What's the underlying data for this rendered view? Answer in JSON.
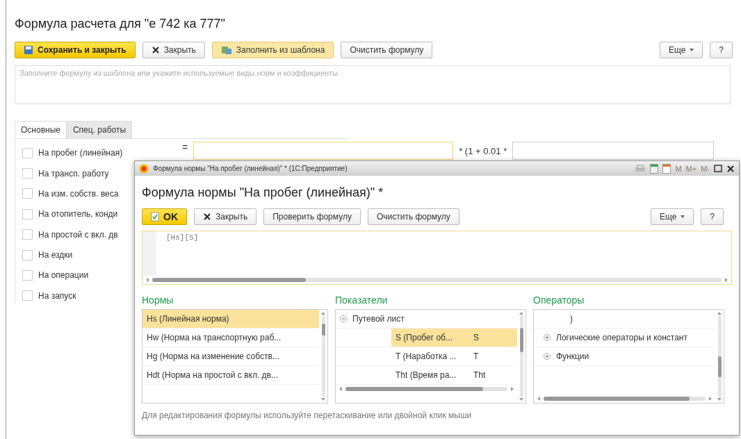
{
  "window": {
    "title": "Формула расчета для \"е 742 ка 777\""
  },
  "toolbar": {
    "buttons": [
      {
        "label": "Сохранить и закрыть",
        "kind": "primary"
      },
      {
        "label": "Закрыть",
        "kind": "close"
      },
      {
        "label": "Заполнить из шаблона",
        "kind": "template"
      },
      {
        "label": "Очистить формулу",
        "kind": "plain"
      }
    ],
    "more": "Еще",
    "help": "?"
  },
  "hint": {
    "placeholder": "Заполните формулу из шаблона или укажите используемые виды норм и коэффициенты"
  },
  "tabs": [
    {
      "label": "Основные",
      "selected": true
    },
    {
      "label": "Спец. работы",
      "selected": false
    }
  ],
  "norms": [
    {
      "label": "На пробег (линейная)",
      "checked": false
    },
    {
      "label": "На трансп. работу",
      "checked": false
    },
    {
      "label": "На изм. собств. веса",
      "checked": false
    },
    {
      "label": "На отопитель, конди",
      "checked": false
    },
    {
      "label": "На простой с вкл. дв",
      "checked": false
    },
    {
      "label": "На ездки",
      "checked": false
    },
    {
      "label": "На операции",
      "checked": false
    },
    {
      "label": "На запуск",
      "checked": false
    }
  ],
  "formula_row": {
    "equals": "=",
    "multiplier": "* (1 + 0.01 *"
  },
  "dialog": {
    "title_bar": "Формула нормы \"На пробег (линейная)\" *  (1С:Предприятие)",
    "memory_buttons": [
      "M",
      "M+",
      "M-"
    ],
    "heading": "Формула нормы \"На пробег (линейная)\" *",
    "toolbar": {
      "buttons": [
        {
          "label": "OK",
          "kind": "ok"
        },
        {
          "label": "Закрыть",
          "kind": "close"
        },
        {
          "label": "Проверить формулу",
          "kind": "plain"
        },
        {
          "label": "Очистить формулу",
          "kind": "plain"
        }
      ],
      "more": "Еще",
      "help": "?"
    },
    "formula": "[Hs][S]",
    "norms": {
      "title": "Нормы",
      "items": [
        {
          "label": "Hs (Линейная норма)",
          "selected": true
        },
        {
          "label": "Hw (Норма на транспортную раб...",
          "selected": false
        },
        {
          "label": "Hg (Норма на изменение собств...",
          "selected": false
        },
        {
          "label": "Hdt (Норма на простой с вкл. дв...",
          "selected": false
        }
      ]
    },
    "indicators": {
      "title": "Показатели",
      "items": [
        {
          "label": "Путевой лист",
          "expanded": true,
          "children": [
            {
              "label": "S (Пробег об...",
              "code": "S",
              "selected": true
            },
            {
              "label": "T (Наработка ...",
              "code": "T",
              "selected": false
            },
            {
              "label": "Tht (Время ра...",
              "code": "Tht",
              "selected": false
            }
          ]
        }
      ]
    },
    "operators": {
      "title": "Операторы",
      "items": [
        {
          "label": ")",
          "kind": "operator"
        },
        {
          "label": "Логические операторы и констант",
          "kind": "group",
          "expanded": false
        },
        {
          "label": "Функции",
          "kind": "group",
          "expanded": false
        }
      ]
    },
    "footer": "Для редактирования формулы используйте перетаскивание или двойной клик мыши"
  }
}
